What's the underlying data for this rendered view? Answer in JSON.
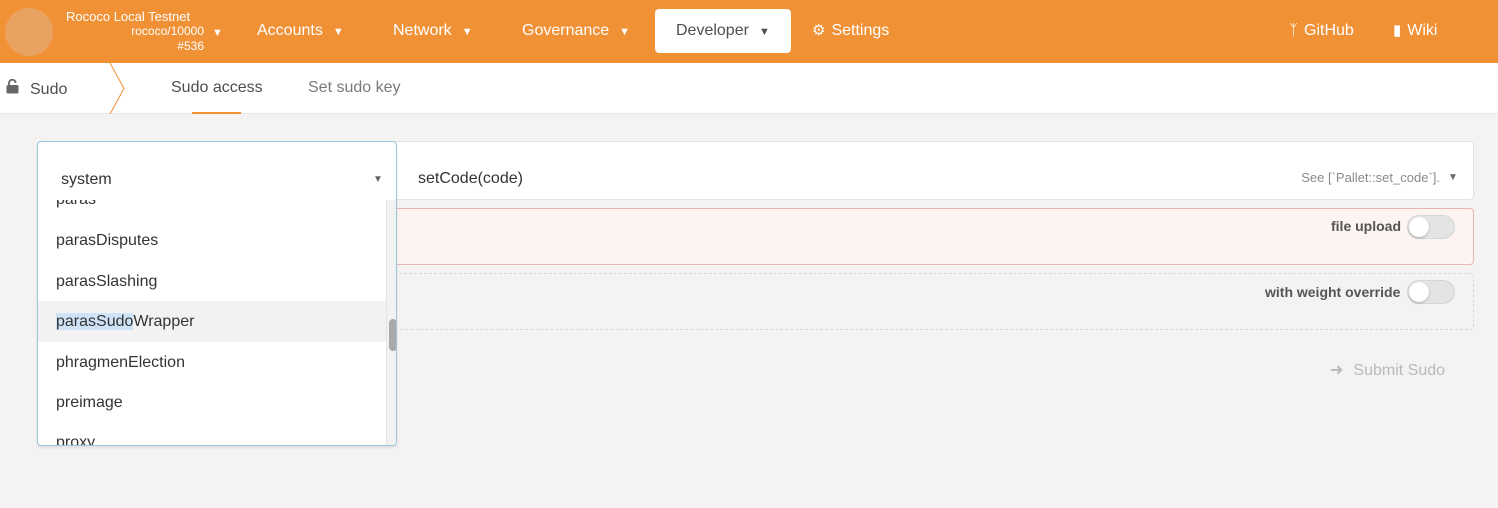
{
  "chain": {
    "name": "Rococo Local Testnet",
    "spec": "rococo/10000",
    "block": "#536"
  },
  "nav": {
    "accounts": "Accounts",
    "network": "Network",
    "governance": "Governance",
    "developer": "Developer",
    "settings": "Settings",
    "github": "GitHub",
    "wiki": "Wiki"
  },
  "subnav": {
    "section": "Sudo",
    "tabs": [
      "Sudo access",
      "Set sudo key"
    ]
  },
  "extrinsic": {
    "pallet": "system",
    "method": "setCode(code)",
    "description": "See [`Pallet::set_code`]."
  },
  "dropdown": {
    "items": [
      "paras",
      "parasDisputes",
      "parasSlashing",
      "parasSudoWrapper",
      "phragmenElection",
      "preimage",
      "proxy"
    ],
    "selected_index": 3,
    "search_highlight": "parasSudo",
    "selected_rest": "Wrapper"
  },
  "toggles": {
    "file_upload": {
      "label": "file upload",
      "on": false
    },
    "weight_override": {
      "label": "with weight override",
      "on": false
    }
  },
  "submit": {
    "label": "Submit Sudo"
  },
  "colors": {
    "accent": "#f19135",
    "error_bg": "#fdf3f1",
    "focus_border": "#96c8da",
    "highlight": "#cfe3f7"
  }
}
